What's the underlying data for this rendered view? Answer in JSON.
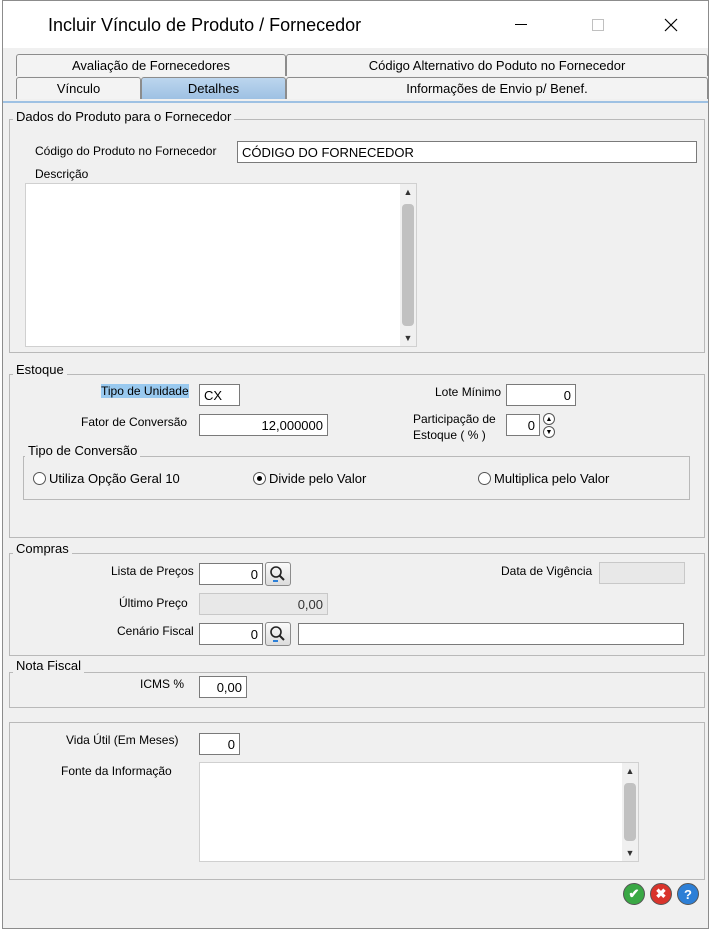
{
  "window": {
    "title": "Incluir Vínculo de Produto / Fornecedor"
  },
  "tabs": {
    "row1": [
      "Avaliação de Fornecedores",
      "Código Alternativo do Poduto no Fornecedor"
    ],
    "row2": [
      "Vínculo",
      "Detalhes",
      "Informações de Envio p/ Benef."
    ],
    "active": "Detalhes"
  },
  "dados": {
    "group_label": "Dados do Produto para o Fornecedor",
    "codigo_label": "Código do Produto no Fornecedor",
    "codigo_value": "CÓDIGO DO FORNECEDOR",
    "descricao_label": "Descrição",
    "descricao_value": ""
  },
  "estoque": {
    "group_label": "Estoque",
    "tipo_unidade_label": "Tipo de Unidade",
    "tipo_unidade_value": "CX",
    "fator_label": "Fator de Conversão",
    "fator_value": "12,000000",
    "lote_label": "Lote Mínimo",
    "lote_value": "0",
    "participacao_label_1": "Participação de",
    "participacao_label_2": "Estoque ( % )",
    "participacao_value": "0",
    "tipo_conversao_label": "Tipo de Conversão",
    "radios": [
      {
        "label": "Utiliza Opção Geral 10",
        "checked": false
      },
      {
        "label": "Divide pelo Valor",
        "checked": true
      },
      {
        "label": "Multiplica pelo Valor",
        "checked": false
      }
    ]
  },
  "compras": {
    "group_label": "Compras",
    "lista_label": "Lista de Preços",
    "lista_value": "0",
    "data_vigencia_label": "Data de Vigência",
    "data_vigencia_value": "",
    "ultimo_preco_label": "Último Preço",
    "ultimo_preco_value": "0,00",
    "cenario_label": "Cenário Fiscal",
    "cenario_value": "0",
    "cenario_desc": ""
  },
  "nota_fiscal": {
    "group_label": "Nota Fiscal",
    "icms_label": "ICMS %",
    "icms_value": "0,00"
  },
  "outros": {
    "vida_util_label": "Vida Útil (Em Meses)",
    "vida_util_value": "0",
    "fonte_label": "Fonte da Informação",
    "fonte_value": ""
  },
  "colors": {
    "tab_active": "#9ec1e3",
    "ok": "#3aa845",
    "cancel": "#d9342b",
    "help": "#2d7fd6",
    "highlight": "#99c9ef"
  }
}
